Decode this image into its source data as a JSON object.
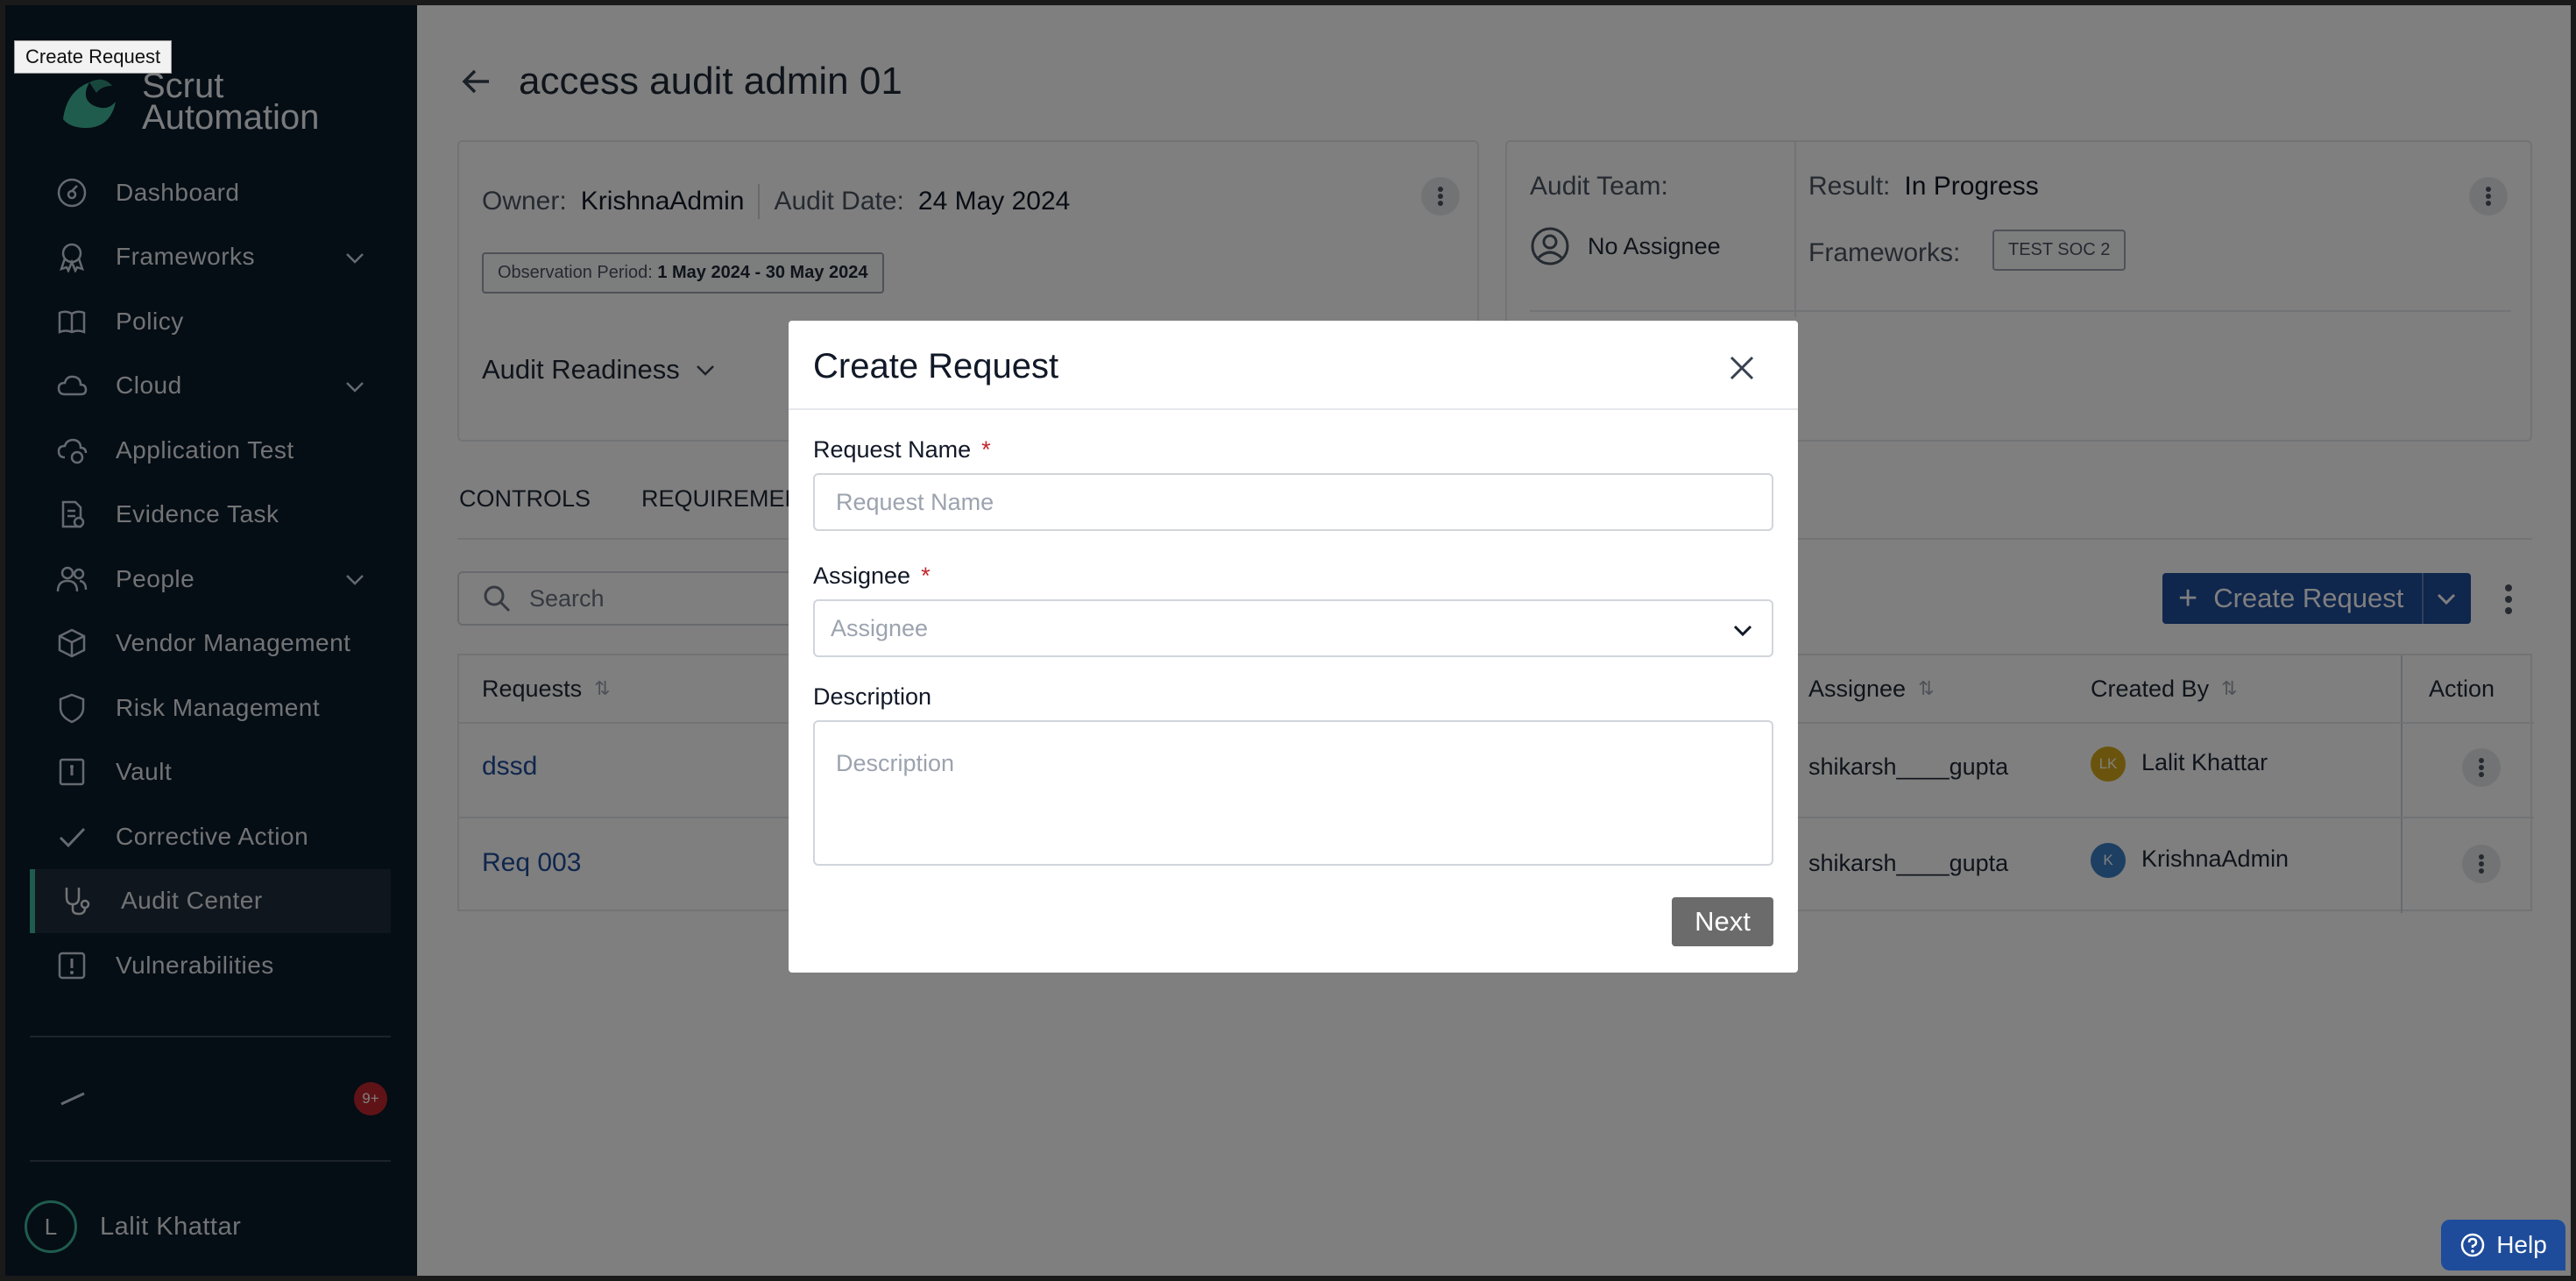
{
  "tooltip": "Create Request",
  "sidebar": {
    "logo_line1": "Scrut",
    "logo_line2": "Automation",
    "items": [
      {
        "label": "Dashboard",
        "icon": "dashboard-icon"
      },
      {
        "label": "Frameworks",
        "icon": "award-icon"
      },
      {
        "label": "Policy",
        "icon": "book-icon"
      },
      {
        "label": "Cloud",
        "icon": "cloud-icon"
      },
      {
        "label": "Application Test",
        "icon": "app-test-icon"
      },
      {
        "label": "Evidence Task",
        "icon": "evidence-icon"
      },
      {
        "label": "People",
        "icon": "people-icon"
      },
      {
        "label": "Vendor Management",
        "icon": "box-icon"
      },
      {
        "label": "Risk Management",
        "icon": "shield-icon"
      },
      {
        "label": "Vault",
        "icon": "vault-icon"
      },
      {
        "label": "Corrective Action",
        "icon": "check-icon"
      },
      {
        "label": "Audit Center",
        "icon": "stethoscope-icon"
      },
      {
        "label": "Vulnerabilities",
        "icon": "alert-icon"
      }
    ],
    "updates_badge": "9+",
    "user_initial": "L",
    "user_name": "Lalit Khattar"
  },
  "header": {
    "title": "access audit admin 01"
  },
  "audit_info": {
    "owner_label": "Owner:",
    "owner_value": "KrishnaAdmin",
    "date_label": "Audit Date:",
    "date_value": "24 May 2024",
    "observation_label": "Observation Period:",
    "observation_value": "1 May 2024 - 30 May 2024",
    "readiness_label": "Audit Readiness"
  },
  "audit_team": {
    "team_label": "Audit Team:",
    "assignee": "No Assignee",
    "result_label": "Result:",
    "result_value": "In Progress",
    "frameworks_label": "Frameworks:",
    "framework_tag": "TEST SOC 2"
  },
  "tabs": [
    "CONTROLS",
    "REQUIREMENTS"
  ],
  "search": {
    "placeholder": "Search"
  },
  "create_button": {
    "label": "Create Request"
  },
  "table": {
    "columns": {
      "requests": "Requests",
      "assignee": "Assignee",
      "created_by": "Created By",
      "action": "Action"
    },
    "rows": [
      {
        "request": "dssd",
        "assignee": "shikarsh____gupta",
        "created_by": "Lalit Khattar",
        "creator_initials": "LK",
        "creator_color": "#d4a91b"
      },
      {
        "request": "Req 003",
        "assignee": "shikarsh____gupta",
        "created_by": "KrishnaAdmin",
        "creator_initials": "K",
        "creator_color": "#3b7fc4"
      }
    ]
  },
  "help": {
    "label": "Help"
  },
  "modal": {
    "title": "Create Request",
    "request_name_label": "Request Name",
    "request_name_placeholder": "Request Name",
    "assignee_label": "Assignee",
    "assignee_placeholder": "Assignee",
    "description_label": "Description",
    "description_placeholder": "Description",
    "required_marker": "*",
    "next_label": "Next"
  },
  "colors": {
    "sidebar_bg": "#0b1a2a",
    "accent_green": "#3fb99a",
    "primary_blue": "#1e4c9a",
    "badge_red": "#c0262d"
  }
}
